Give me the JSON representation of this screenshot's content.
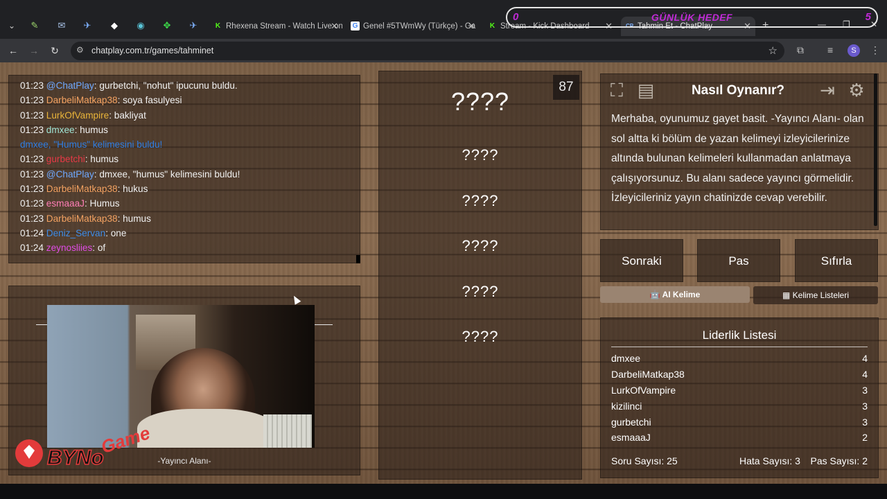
{
  "browser": {
    "tabs": [
      {
        "label": "Rhexena Stream - Watch Live on",
        "icon": "kick-icon",
        "active": false
      },
      {
        "label": "Genel #5TWmWy (Türkçe) - Ga",
        "icon": "g-icon",
        "active": false
      },
      {
        "label": "Stream - Kick Dashboard",
        "icon": "kick-icon",
        "active": false
      },
      {
        "label": "Tahmin Et - ChatPlay",
        "icon": "cp-icon",
        "active": true
      }
    ],
    "active_tab_favicon": "CP",
    "url": "chatplay.com.tr/games/tahminet"
  },
  "goal_overlay": {
    "title": "GÜNLÜK HEDEF",
    "current": "0",
    "target": "5"
  },
  "chat": {
    "messages": [
      {
        "time": "01:23",
        "user": "@ChatPlay",
        "color": "#6ea8ff",
        "text": ": gurbetchi, \"nohut\" ipucunu buldu."
      },
      {
        "time": "01:23",
        "user": "DarbeliMatkap38",
        "color": "#f4a261",
        "text": ": soya fasulyesi"
      },
      {
        "time": "01:23",
        "user": "LurkOfVampire",
        "color": "#e9b43a",
        "text": ": bakliyat"
      },
      {
        "time": "01:23",
        "user": "dmxee",
        "color": "#9fe3d4",
        "text": ": humus"
      },
      {
        "time": "",
        "user": "",
        "color": "#2f7de1",
        "text": "dmxee, \"Humus\" kelimesini buldu!",
        "system": true
      },
      {
        "time": "01:23",
        "user": "gurbetchi",
        "color": "#e63946",
        "text": ": humus"
      },
      {
        "time": "01:23",
        "user": "@ChatPlay",
        "color": "#6ea8ff",
        "text": ": dmxee, \"humus\" kelimesini buldu!"
      },
      {
        "time": "01:23",
        "user": "DarbeliMatkap38",
        "color": "#f4a261",
        "text": ": hukus"
      },
      {
        "time": "01:23",
        "user": "esmaaaJ",
        "color": "#ff7eb6",
        "text": ": Humus"
      },
      {
        "time": "01:23",
        "user": "DarbeliMatkap38",
        "color": "#f4a261",
        "text": ": humus"
      },
      {
        "time": "01:24",
        "user": "Deniz_Servan",
        "color": "#3f8de8",
        "text": ": one"
      },
      {
        "time": "01:24",
        "user": "zeynosliies",
        "color": "#e04ce6",
        "text": ": of"
      }
    ]
  },
  "stream": {
    "caption": "-Yayıncı Alanı-",
    "logo_text": "BYNo Game"
  },
  "words": {
    "timer": "87",
    "main": "????",
    "list": [
      "????",
      "????",
      "????",
      "????",
      "????"
    ]
  },
  "howto": {
    "title": "Nasıl Oynanır?",
    "text": "Merhaba, oyunumuz gayet basit. -Yayıncı Alanı- olan sol altta ki bölüm de yazan kelimeyi izleyicilerinize altında bulunan kelimeleri kullanmadan anlatmaya çalışıyorsunuz. Bu alanı sadece yayıncı görmelidir. İzleyicileriniz yayın chatinizde cevap verebilir."
  },
  "actions": {
    "next": "Sonraki",
    "pass": "Pas",
    "reset": "Sıfırla",
    "ai_word": "AI Kelime",
    "word_lists": "Kelime Listeleri"
  },
  "leaderboard": {
    "title": "Liderlik Listesi",
    "rows": [
      {
        "name": "dmxee",
        "score": "4"
      },
      {
        "name": "DarbeliMatkap38",
        "score": "4"
      },
      {
        "name": "LurkOfVampire",
        "score": "3"
      },
      {
        "name": "kizilinci",
        "score": "3"
      },
      {
        "name": "gurbetchi",
        "score": "3"
      },
      {
        "name": "esmaaaJ",
        "score": "2"
      }
    ],
    "questions": "Soru Sayısı: 25",
    "errors": "Hata Sayısı: 3",
    "passes": "Pas Sayısı: 2"
  }
}
